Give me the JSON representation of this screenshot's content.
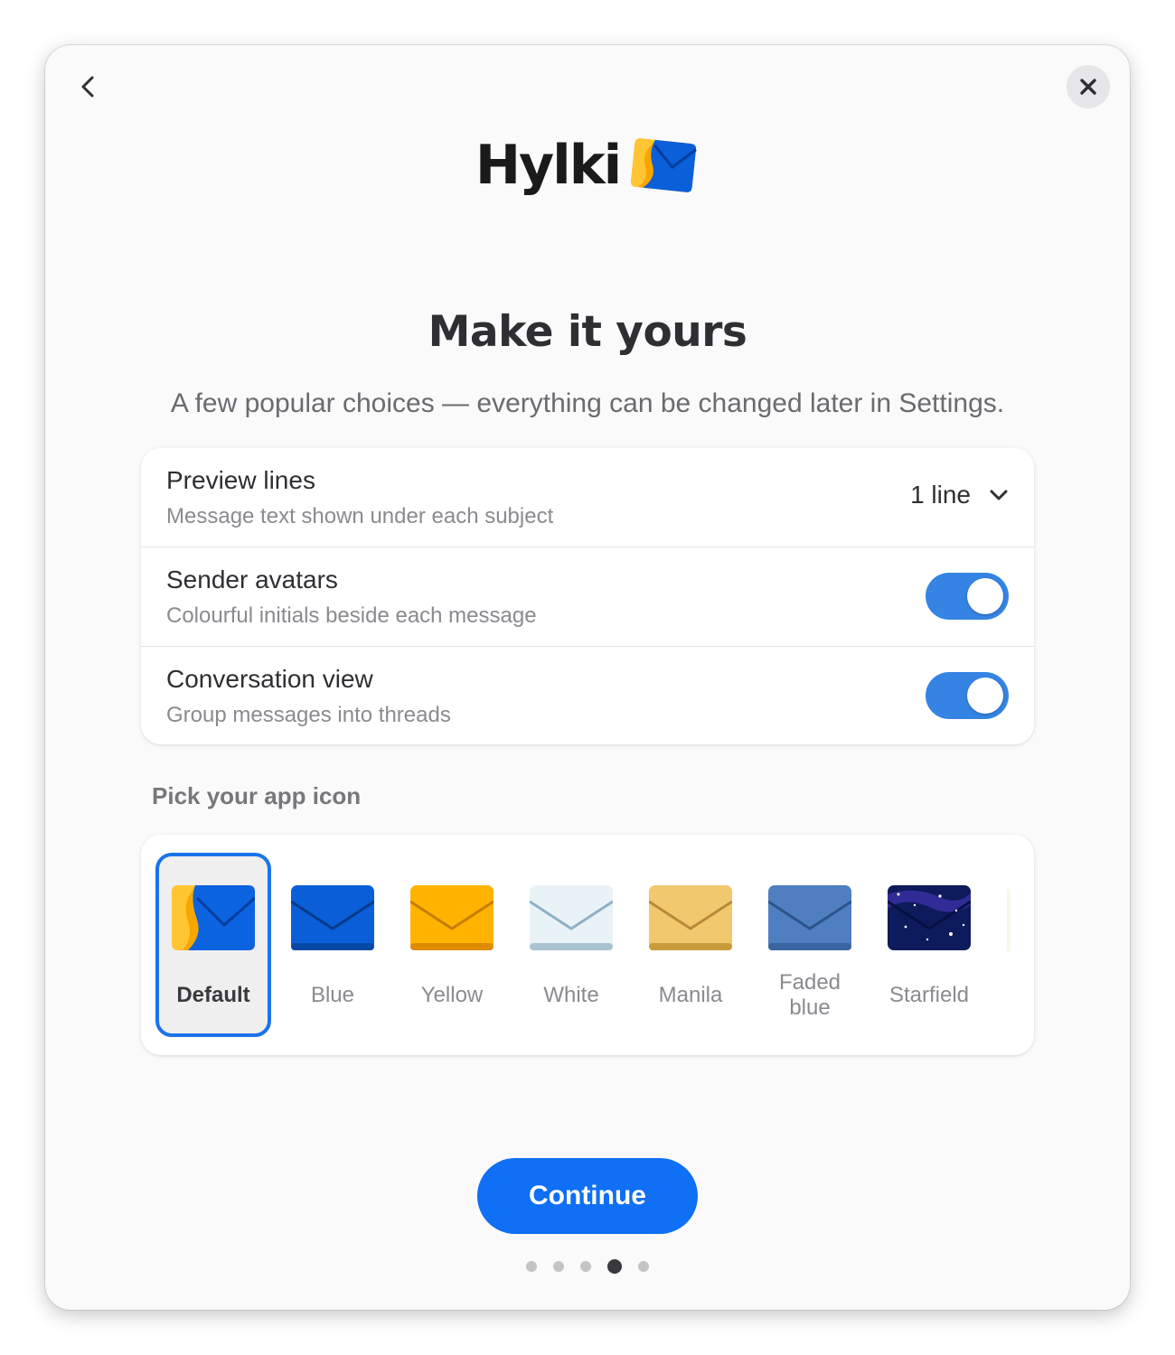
{
  "dialog": {
    "back_icon": "chevron-left-icon",
    "close_icon": "close-icon",
    "logo_text": "Hylki",
    "title": "Make it yours",
    "subtitle": "A few popular choices — everything can be changed later in Settings."
  },
  "settings": [
    {
      "title": "Preview lines",
      "description": "Message text shown under each subject",
      "control": "dropdown",
      "value": "1 line"
    },
    {
      "title": "Sender avatars",
      "description": "Colourful initials beside each message",
      "control": "toggle",
      "on": true
    },
    {
      "title": "Conversation view",
      "description": "Group messages into threads",
      "control": "toggle",
      "on": true
    }
  ],
  "icon_section": {
    "label": "Pick your app icon",
    "options": [
      {
        "label": "Default",
        "selected": true
      },
      {
        "label": "Blue",
        "selected": false
      },
      {
        "label": "Yellow",
        "selected": false
      },
      {
        "label": "White",
        "selected": false
      },
      {
        "label": "Manila",
        "selected": false
      },
      {
        "label": "Faded blue",
        "selected": false
      },
      {
        "label": "Starfield",
        "selected": false
      }
    ]
  },
  "continue_label": "Continue",
  "pager": {
    "total": 5,
    "current": 4
  },
  "colors": {
    "accent": "#0f6ff5",
    "toggle_on": "#3584e4",
    "selected_border": "#1a73e8"
  }
}
